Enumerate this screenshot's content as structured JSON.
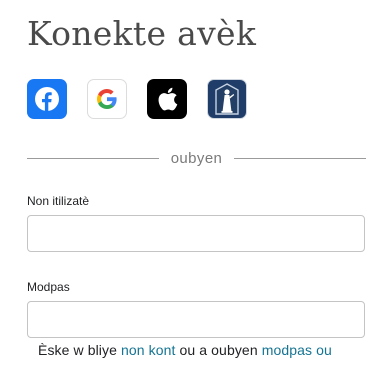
{
  "login": {
    "title": "Konekte avèk",
    "social": [
      {
        "name": "facebook",
        "icon": "facebook-icon",
        "color": "#1877f2"
      },
      {
        "name": "google",
        "icon": "google-icon",
        "color": "#ffffff"
      },
      {
        "name": "apple",
        "icon": "apple-icon",
        "color": "#000000"
      },
      {
        "name": "church",
        "icon": "church-statue-icon",
        "color": "#1f3d68"
      }
    ],
    "divider_text": "oubyen",
    "username_label": "Non itilizatè",
    "username_value": "",
    "password_label": "Modpas",
    "password_value": "",
    "forgot": {
      "prefix": "Èske w bliye",
      "username_link": "non kont",
      "middle": "ou a oubyen",
      "password_link": "modpas ou"
    }
  },
  "colors": {
    "link": "#157493",
    "title": "#4a4a4a",
    "divider": "#9b9b9b"
  }
}
